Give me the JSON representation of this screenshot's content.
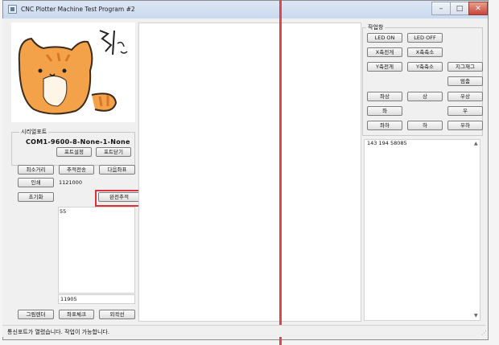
{
  "window": {
    "title": "CNC Plotter Machine Test Program #2",
    "controls": {
      "minimize": "–",
      "maximize": "□",
      "close": "✕"
    }
  },
  "serial": {
    "caption": "시리얼포트",
    "status": "COM1-9600-8-None-1-None",
    "settings_label": "포트설정",
    "close_label": "포트닫기"
  },
  "controls": {
    "min_distance_label": "최소거리",
    "send_coord_label": "추적전송",
    "next_label": "다음좌표",
    "print_label": "인쇄",
    "print_value": "1121000",
    "reset_label": "초기화",
    "full_trace_label": "완전추적",
    "count_value": "55",
    "bottom_value": "11905",
    "draw_label": "그림렌더",
    "coord_check_label": "좌표체크",
    "outline_label": "외곽선"
  },
  "operations": {
    "caption": "작업창",
    "led_on": "LED ON",
    "led_off": "LED OFF",
    "x_plus": "X축전게",
    "x_minus": "X축축소",
    "y_plus": "Y축전게",
    "y_minus": "Y축축소",
    "zigzag": "지그재그",
    "stop": "멈춤",
    "up_left": "좌상",
    "up": "상",
    "up_right": "우상",
    "left": "좌",
    "right": "우",
    "down_left": "좌하",
    "down": "하",
    "down_right": "우하"
  },
  "log": {
    "text": "143  194  58085"
  },
  "status_bar": {
    "text": "통신포트가 열렸습니다. 작업이 가능합니다."
  },
  "colors": {
    "highlight": "#d9343a",
    "divider": "#e0454a",
    "cat_body": "#f3a24a",
    "cat_stripes": "#d9762a"
  }
}
